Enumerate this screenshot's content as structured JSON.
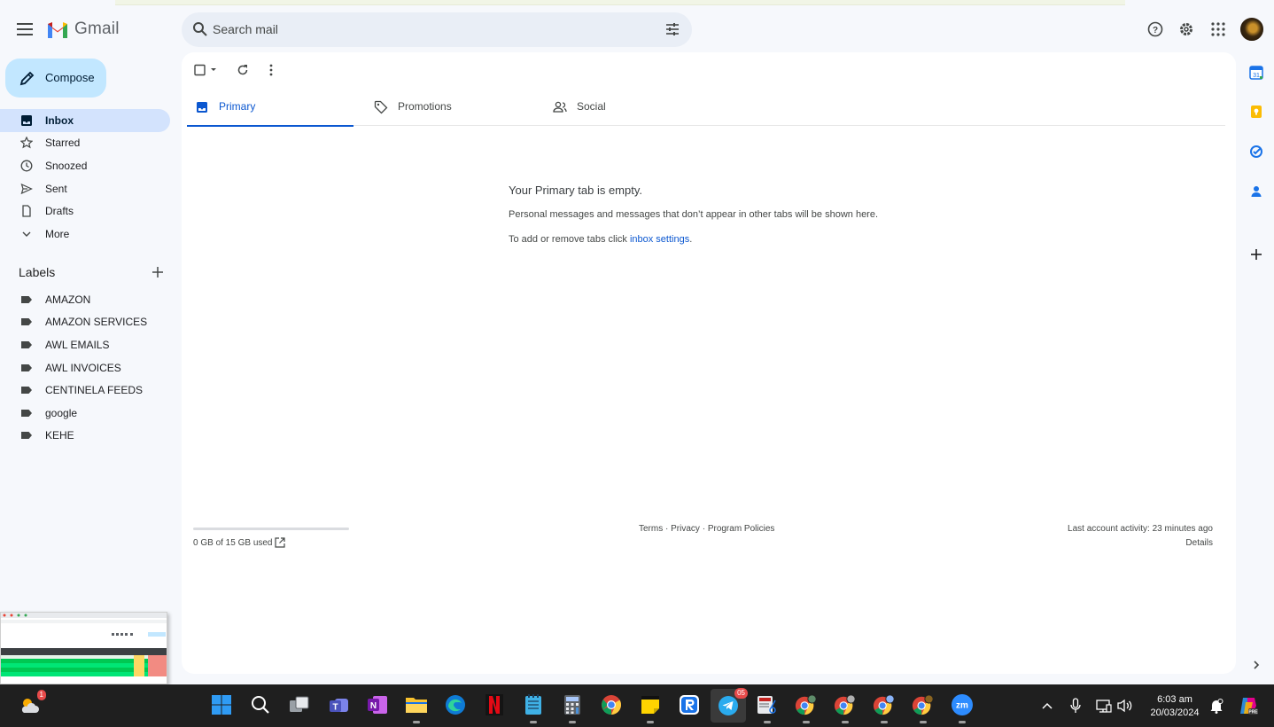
{
  "app": {
    "logo_text": "Gmail"
  },
  "search": {
    "placeholder": "Search mail"
  },
  "compose": {
    "label": "Compose"
  },
  "nav": {
    "items": [
      {
        "label": "Inbox",
        "icon": "inbox-icon"
      },
      {
        "label": "Starred",
        "icon": "star-icon"
      },
      {
        "label": "Snoozed",
        "icon": "clock-icon"
      },
      {
        "label": "Sent",
        "icon": "send-icon"
      },
      {
        "label": "Drafts",
        "icon": "draft-icon"
      },
      {
        "label": "More",
        "icon": "chevron-down-icon"
      }
    ]
  },
  "labels": {
    "heading": "Labels",
    "items": [
      "AMAZON",
      "AMAZON SERVICES",
      "AWL EMAILS",
      "AWL INVOICES",
      "CENTINELA FEEDS",
      "google",
      "KEHE"
    ]
  },
  "tabs": [
    {
      "label": "Primary",
      "icon": "inbox-tray-icon"
    },
    {
      "label": "Promotions",
      "icon": "tag-icon"
    },
    {
      "label": "Social",
      "icon": "people-icon"
    }
  ],
  "empty": {
    "title": "Your Primary tab is empty.",
    "description": "Personal messages and messages that don’t appear in other tabs will be shown here.",
    "hint_prefix": "To add or remove tabs click ",
    "hint_link": "inbox settings",
    "hint_suffix": "."
  },
  "footer": {
    "storage_text": "0 GB of 15 GB used",
    "storage_fraction": 0,
    "terms": "Terms",
    "privacy": "Privacy",
    "policies": "Program Policies",
    "sep": " · ",
    "activity": "Last account activity: 23 minutes ago",
    "details": "Details"
  },
  "taskbar": {
    "weather_badge": "1",
    "telegram_badge": "05",
    "time": "6:03 am",
    "date": "20/03/2024"
  },
  "colors": {
    "accent": "#0b57d0",
    "compose_bg": "#c2e7ff",
    "active_nav": "#d3e3fd",
    "page_bg": "#f6f8fc",
    "taskbar_bg": "#1f1f1f"
  }
}
